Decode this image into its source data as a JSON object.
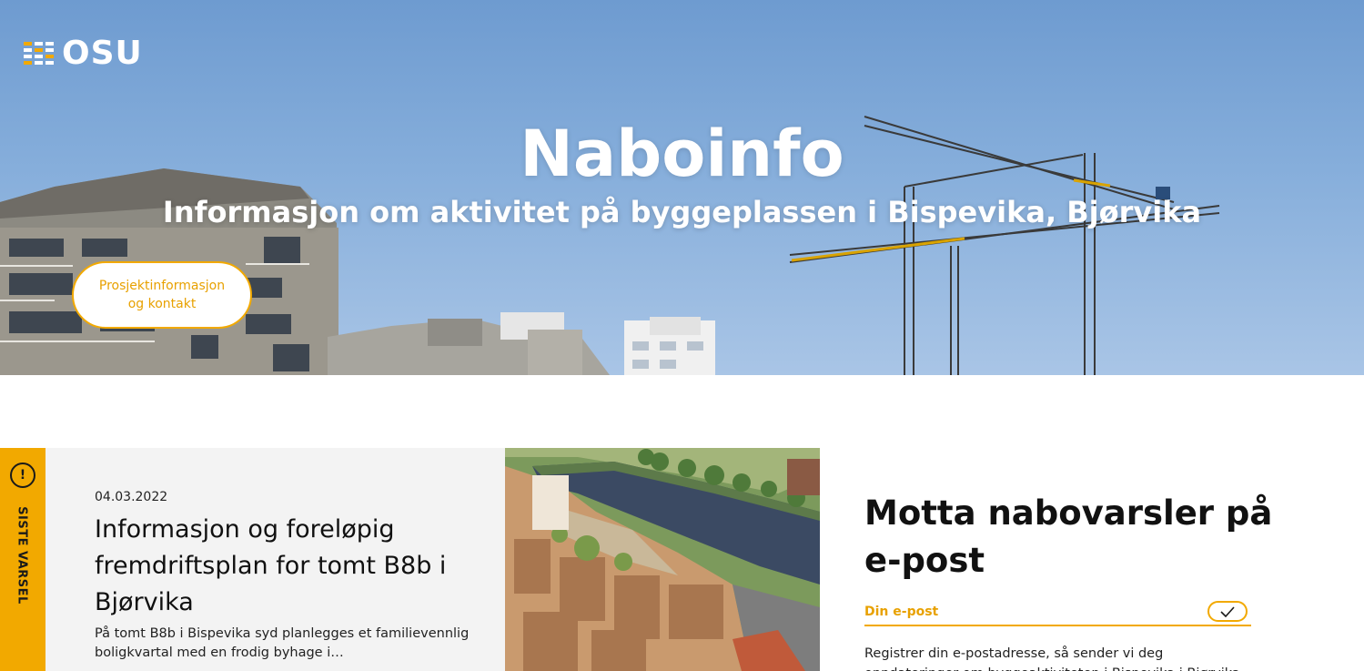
{
  "header": {
    "logo_text": "OSU",
    "logo_alt": "OSU logo"
  },
  "hero": {
    "title": "Naboinfo",
    "subtitle": "Informasjon om aktivitet på byggeplassen i Bispevika, Bjørvika",
    "cta_label": "Prosjektinformasjon og kontakt"
  },
  "notice": {
    "tab_label": "SISTE VARSEL",
    "alert_icon": "!",
    "date": "04.03.2022",
    "title": "Informasjon og foreløpig fremdriftsplan for tomt B8b i Bjørvika",
    "excerpt": "På tomt B8b i Bispevika syd planlegges et familievennlig boligkvartal med en frodig byhage i…"
  },
  "newsletter": {
    "title": "Motta nabovarsler på e-post",
    "email_placeholder": "Din e-post",
    "submit_icon": "check-icon",
    "description": "Registrer din e-postadresse, så sender vi deg oppdateringer om byggeaktiviteten i Bispevika i Bjørvika."
  },
  "colors": {
    "accent": "#f2a900",
    "card_bg": "#f3f3f3",
    "sky": "#86aedb"
  }
}
